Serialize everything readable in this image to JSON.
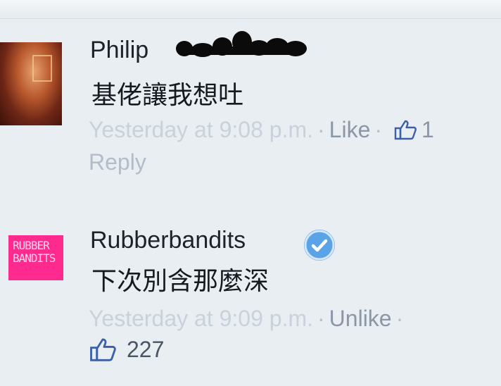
{
  "comments": [
    {
      "author": "Philip",
      "message": "基佬讓我想吐",
      "timestamp": "Yesterday at 9:08 p.m.",
      "like_label": "Like",
      "like_count": "1",
      "reply_label": "Reply"
    },
    {
      "author": "Rubberbandits",
      "verified": true,
      "avatar_text_line1": "RUBBER",
      "avatar_text_line2": "BANDITS",
      "message": "下次別含那麼深",
      "timestamp": "Yesterday at 9:09 p.m.",
      "like_label": "Unlike",
      "like_count": "227"
    }
  ],
  "icons": {
    "like": "thumbs-up-icon",
    "verified": "verified-badge-icon",
    "redaction": "redaction-scribble"
  },
  "colors": {
    "background": "#e9eef3",
    "name_text": "#1d2129",
    "meta_text": "#a7b0bc",
    "link_text": "#8c97a6",
    "verified": "#5aa3e6",
    "like_icon": "#3b5fa8",
    "logo_bg": "#ff2a8e"
  }
}
